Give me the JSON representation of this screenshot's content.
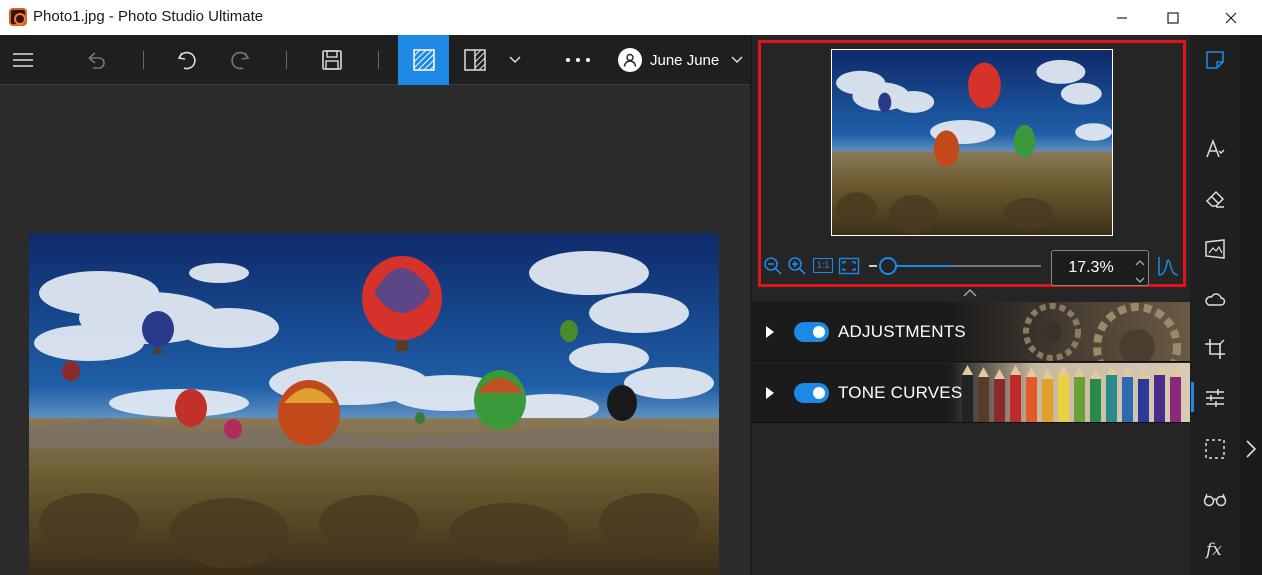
{
  "window": {
    "title": "Photo1.jpg - Photo Studio Ultimate"
  },
  "toolbar": {
    "user_name": "June June"
  },
  "navigator": {
    "zoom_value": "17.3%",
    "zoom_slider_fraction": 0.45,
    "actual_size_label": "1:1"
  },
  "panels": [
    {
      "label": "ADJUSTMENTS",
      "enabled": true
    },
    {
      "label": "TONE CURVES",
      "enabled": true
    }
  ],
  "colors": {
    "accent": "#1e88e5",
    "highlight": "#e0141b",
    "background": "#2b2b2b"
  }
}
